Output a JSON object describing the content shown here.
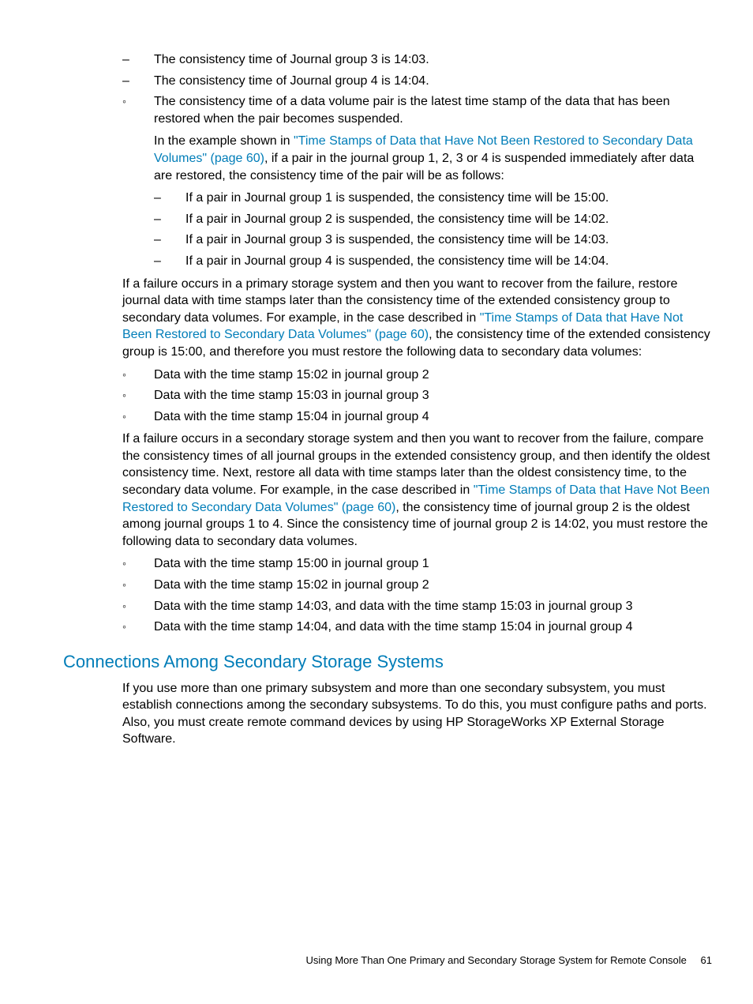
{
  "top_dash": [
    "The consistency time of Journal group 3 is 14:03.",
    "The consistency time of Journal group 4 is 14:04."
  ],
  "circle1": {
    "lead": "The consistency time of a data volume pair is the latest time stamp of the data that has been restored when the pair becomes suspended.",
    "p_pre": "In the example shown in ",
    "p_link": "\"Time Stamps of Data that Have Not Been Restored to Secondary Data Volumes\" (page 60)",
    "p_post": ", if a pair in the journal group 1, 2, 3 or 4 is suspended immediately after data are restored, the consistency time of the pair will be as follows:",
    "items": [
      "If a pair in Journal group 1 is suspended, the consistency time will be 15:00.",
      "If a pair in Journal group 2 is suspended, the consistency time will be 14:02.",
      "If a pair in Journal group 3 is suspended, the consistency time will be 14:03.",
      "If a pair in Journal group 4 is suspended, the consistency time will be 14:04."
    ]
  },
  "para2": {
    "pre": "If a failure occurs in a primary storage system and then you want to recover from the failure, restore journal data with time stamps later than the consistency time of the extended consistency group to secondary data volumes. For example, in the case described in ",
    "link": "\"Time Stamps of Data that Have Not Been Restored to Secondary Data Volumes\" (page 60)",
    "post": ", the consistency time of the extended consistency group is 15:00, and therefore you must restore the following data to secondary data volumes:"
  },
  "list2": [
    "Data with the time stamp 15:02 in journal group 2",
    "Data with the time stamp 15:03 in journal group 3",
    "Data with the time stamp 15:04 in journal group 4"
  ],
  "para3": {
    "pre": "If a failure occurs in a secondary storage system and then you want to recover from the failure, compare the consistency times of all journal groups in the extended consistency group, and then identify the oldest consistency time. Next, restore all data with time stamps later than the oldest consistency time, to the secondary data volume. For example, in the case described in ",
    "link": "\"Time Stamps of Data that Have Not Been Restored to Secondary Data Volumes\" (page 60)",
    "post": ", the consistency time of journal group 2 is the oldest among journal groups 1 to 4. Since the consistency time of journal group 2 is 14:02, you must restore the following data to secondary data volumes."
  },
  "list3": [
    "Data with the time stamp 15:00 in journal group 1",
    "Data with the time stamp 15:02 in journal group 2",
    "Data with the time stamp 14:03, and data with the time stamp 15:03 in journal group 3",
    "Data with the time stamp 14:04, and data with the time stamp 15:04 in journal group 4"
  ],
  "section_heading": "Connections Among Secondary Storage Systems",
  "section_para": "If you use more than one primary subsystem and more than one secondary subsystem, you must establish connections among the secondary subsystems. To do this, you must configure paths and ports. Also, you must create remote command devices by using HP StorageWorks XP External Storage Software.",
  "footer_text": "Using More Than One Primary and Secondary Storage System for Remote Console",
  "page_number": "61"
}
